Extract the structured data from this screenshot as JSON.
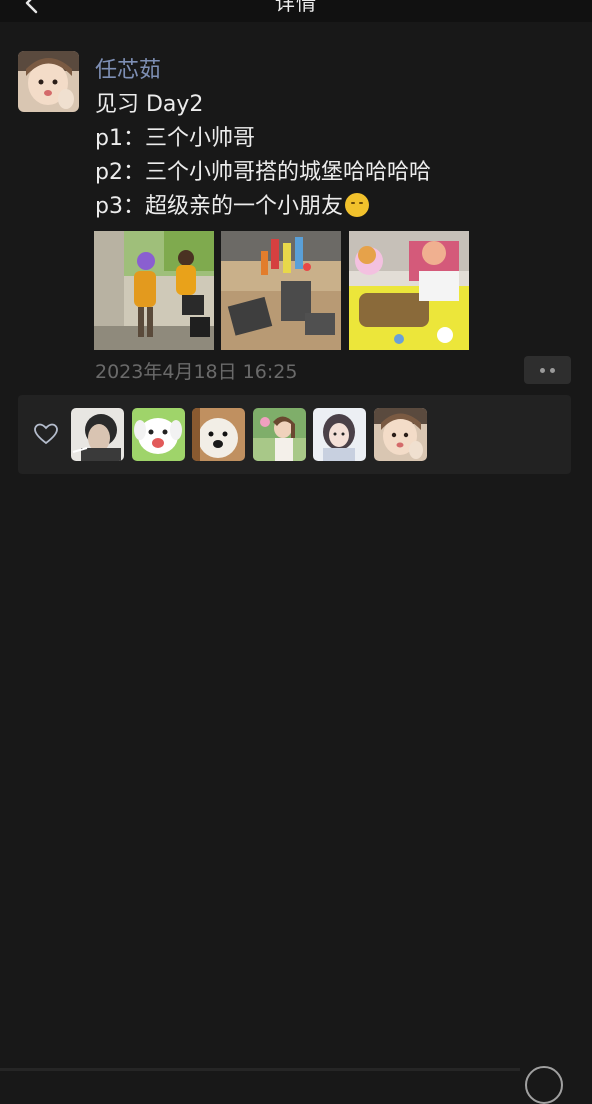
{
  "nav": {
    "title": "详情",
    "back_icon": "chevron-left-icon"
  },
  "post": {
    "author": "任芯茹",
    "lines": [
      "见习 Day2",
      "p1：三个小帅哥",
      "p2：三个小帅哥搭的城堡哈哈哈哈",
      "p3：超级亲的一个小朋友"
    ],
    "emoji": "smiling-face-emoji",
    "photos": [
      {
        "alt": "photo-1"
      },
      {
        "alt": "photo-2"
      },
      {
        "alt": "photo-3"
      }
    ],
    "timestamp": "2023年4月18日 16:25",
    "more_icon": "more-dots-icon"
  },
  "likes": {
    "icon": "heart-icon",
    "count": 6
  },
  "colors": {
    "background": "#181818",
    "author_name": "#7e8fb5",
    "timestamp": "#6a6a6a",
    "panel": "#222222"
  }
}
